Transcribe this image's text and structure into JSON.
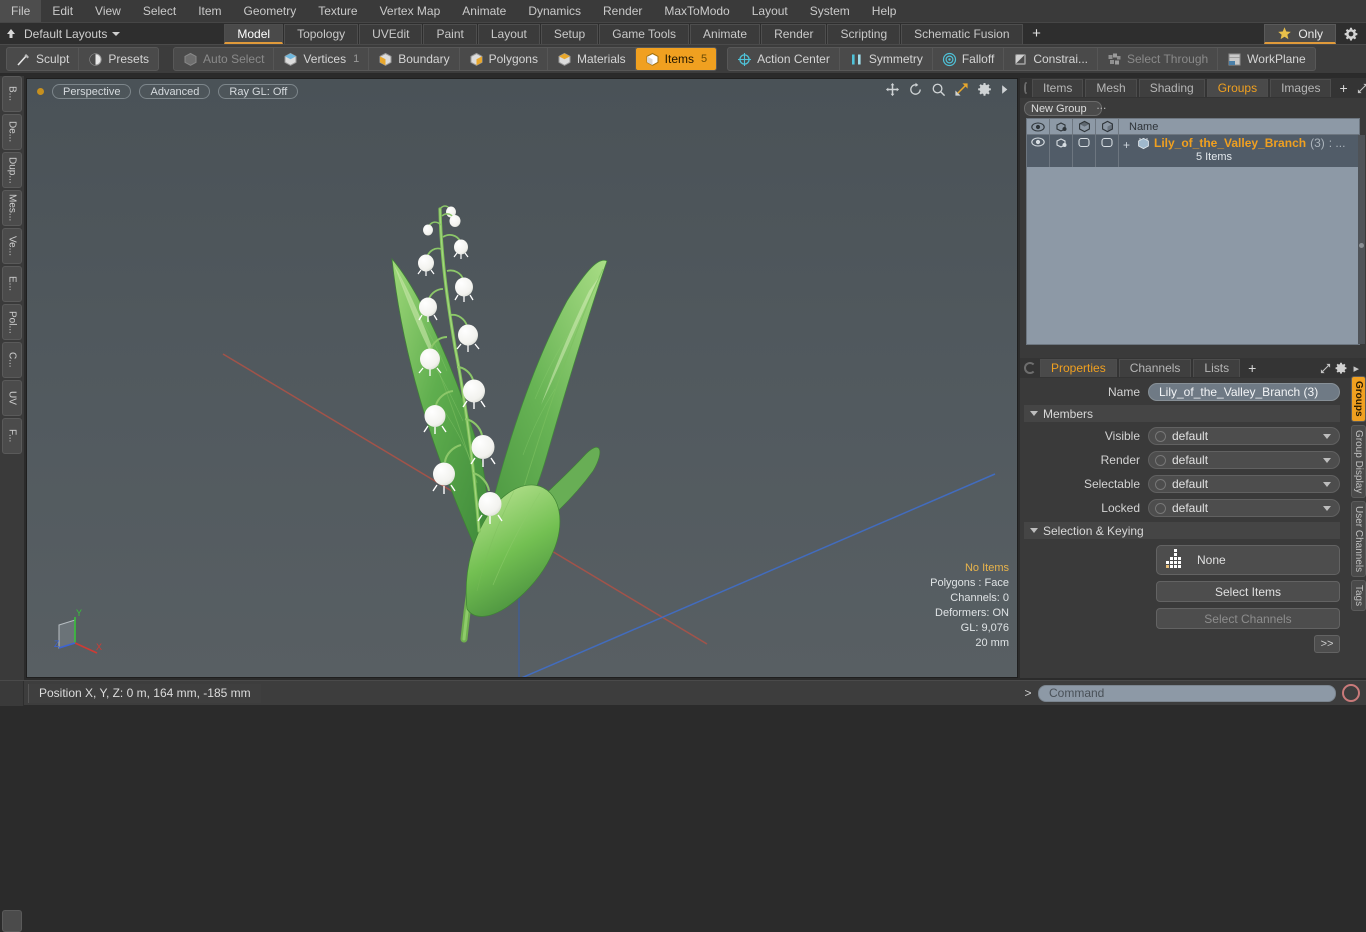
{
  "menu": {
    "items": [
      "File",
      "Edit",
      "View",
      "Select",
      "Item",
      "Geometry",
      "Texture",
      "Vertex Map",
      "Animate",
      "Dynamics",
      "Render",
      "MaxToModo",
      "Layout",
      "System",
      "Help"
    ]
  },
  "layout_bar": {
    "home_icon": "home-arrow-icon",
    "label": "Default Layouts",
    "tabs": [
      {
        "label": "Model",
        "active": true
      },
      {
        "label": "Topology",
        "active": false
      },
      {
        "label": "UVEdit",
        "active": false
      },
      {
        "label": "Paint",
        "active": false
      },
      {
        "label": "Layout",
        "active": false
      },
      {
        "label": "Setup",
        "active": false
      },
      {
        "label": "Game Tools",
        "active": false
      },
      {
        "label": "Animate",
        "active": false
      },
      {
        "label": "Render",
        "active": false
      },
      {
        "label": "Scripting",
        "active": false
      },
      {
        "label": "Schematic Fusion",
        "active": false
      }
    ],
    "add_label": "+",
    "only_label": "Only",
    "only_icon": "star-icon",
    "gear_icon": "gear-icon",
    "accent": "#e09a3a"
  },
  "mode_toolbar": {
    "left_group": [
      {
        "label": "Sculpt",
        "icon": "brush-icon",
        "state": "normal"
      },
      {
        "label": "Presets",
        "icon": "sphere-icon",
        "state": "normal"
      }
    ],
    "select_group": [
      {
        "label": "Auto Select",
        "icon": "cube-grey-icon",
        "state": "dim",
        "count": ""
      },
      {
        "label": "Vertices",
        "icon": "cube-vertices-icon",
        "state": "normal",
        "count": "1"
      },
      {
        "label": "Boundary",
        "icon": "cube-boundary-icon",
        "state": "normal",
        "count": ""
      },
      {
        "label": "Polygons",
        "icon": "cube-polygons-icon",
        "state": "normal",
        "count": ""
      },
      {
        "label": "Materials",
        "icon": "cube-materials-icon",
        "state": "normal",
        "count": ""
      },
      {
        "label": "Items",
        "icon": "cube-items-icon",
        "state": "selected",
        "count": "5"
      }
    ],
    "tools_group": [
      {
        "label": "Action Center",
        "icon": "action-center-icon",
        "state": "normal"
      },
      {
        "label": "Symmetry",
        "icon": "symmetry-icon",
        "state": "normal"
      },
      {
        "label": "Falloff",
        "icon": "falloff-icon",
        "state": "normal"
      },
      {
        "label": "Constrai...",
        "icon": "constraint-icon",
        "state": "normal"
      },
      {
        "label": "Select Through",
        "icon": "select-through-icon",
        "state": "dim"
      },
      {
        "label": "WorkPlane",
        "icon": "workplane-icon",
        "state": "normal"
      }
    ],
    "selected_color": "#f0a020"
  },
  "left_tabs": [
    "B...",
    "De...",
    "Dup...",
    "Mes...",
    "Ve...",
    "E...",
    "Pol...",
    "C...",
    "UV",
    "F..."
  ],
  "viewport": {
    "pills": [
      "Perspective",
      "Advanced",
      "Ray GL: Off"
    ],
    "icons": [
      "move-icon",
      "rotate-icon",
      "zoom-icon",
      "maximize-icon",
      "gear-icon",
      "play-icon"
    ],
    "stats": {
      "items": "No Items",
      "polygons": "Polygons : Face",
      "channels": "Channels: 0",
      "deformers": "Deformers: ON",
      "gl": "GL: 9,076",
      "scale": "20 mm"
    },
    "gizmo": {
      "x": "X",
      "y": "Y",
      "z": "Z"
    },
    "model_name": "Lily of the Valley branch 3D model"
  },
  "groups_panel": {
    "tabs": [
      {
        "label": "Items",
        "active": false
      },
      {
        "label": "Mesh ...",
        "active": false
      },
      {
        "label": "Shading",
        "active": false
      },
      {
        "label": "Groups",
        "active": true
      },
      {
        "label": "Images",
        "active": false
      }
    ],
    "add_label": "+",
    "new_group_button": "New Group",
    "columns": [
      "eye-icon",
      "wireframe-icon",
      "shaded-cube-icon",
      "render-cube-icon",
      "Name"
    ],
    "rows": [
      {
        "name": "Lily_of_the_Valley_Branch",
        "count": "(3)",
        "suffix": ": ...",
        "subtitle": "5 Items"
      }
    ],
    "name_color": "#f0a020"
  },
  "properties_panel": {
    "tabs": [
      {
        "label": "Properties",
        "active": true
      },
      {
        "label": "Channels",
        "active": false
      },
      {
        "label": "Lists",
        "active": false
      }
    ],
    "add_label": "+",
    "expand_icon": "expand-icon",
    "gear_icon": "gear-icon",
    "name_label": "Name",
    "name_value": "Lily_of_the_Valley_Branch (3)",
    "members_section": "Members",
    "fields": [
      {
        "label": "Visible",
        "value": "default"
      },
      {
        "label": "Render",
        "value": "default"
      },
      {
        "label": "Selectable",
        "value": "default"
      },
      {
        "label": "Locked",
        "value": "default"
      }
    ],
    "selection_section": "Selection & Keying",
    "none_value": "None",
    "none_icon": "dotted-cross-icon",
    "select_items_button": "Select Items",
    "select_channels_button": "Select Channels",
    "goto_button": ">>"
  },
  "right_tabs": [
    {
      "label": "Groups",
      "active": true
    },
    {
      "label": "Group Display",
      "active": false
    },
    {
      "label": "User Channels",
      "active": false
    },
    {
      "label": "Tags",
      "active": false
    }
  ],
  "status_bar": {
    "position_text": "Position X, Y, Z:   0 m, 164 mm, -185 mm"
  },
  "command_bar": {
    "prompt": ">",
    "placeholder": "Command",
    "record_icon": "record-icon"
  }
}
